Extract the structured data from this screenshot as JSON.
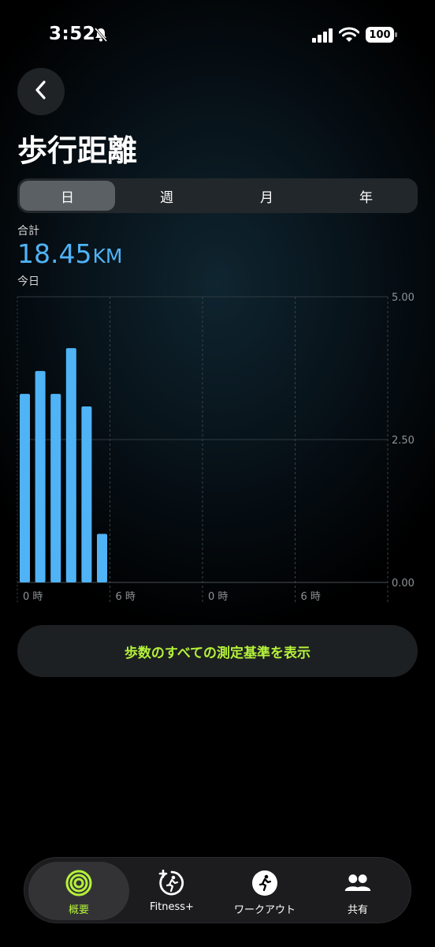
{
  "status": {
    "time": "3:52",
    "battery": "100"
  },
  "header": {
    "title": "歩行距離"
  },
  "segments": [
    {
      "label": "日",
      "active": true
    },
    {
      "label": "週",
      "active": false
    },
    {
      "label": "月",
      "active": false
    },
    {
      "label": "年",
      "active": false
    }
  ],
  "summary": {
    "total_label": "合計",
    "total_value": "18.45",
    "total_unit": "KM",
    "period_label": "今日"
  },
  "chart_data": {
    "type": "bar",
    "x_ticks": [
      "0 時",
      "6 時",
      "0 時",
      "6 時"
    ],
    "y_ticks": [
      "5.00",
      "2.50",
      "0.00"
    ],
    "ylim": [
      0,
      5
    ],
    "values": [
      3.3,
      3.7,
      3.3,
      4.1,
      3.08,
      0.85
    ],
    "color": "#4fb3f6",
    "grid": true
  },
  "actions": {
    "show_all_metrics": "歩数のすべての測定基準を表示"
  },
  "tabbar": {
    "items": [
      {
        "label": "概要",
        "icon": "activity-rings-icon",
        "active": true
      },
      {
        "label": "Fitness+",
        "icon": "fitness-plus-icon",
        "active": false
      },
      {
        "label": "ワークアウト",
        "icon": "workout-runner-icon",
        "active": false
      },
      {
        "label": "共有",
        "icon": "sharing-people-icon",
        "active": false
      }
    ]
  },
  "colors": {
    "accent": "#b5f23a",
    "value_blue": "#4fb3f6"
  }
}
